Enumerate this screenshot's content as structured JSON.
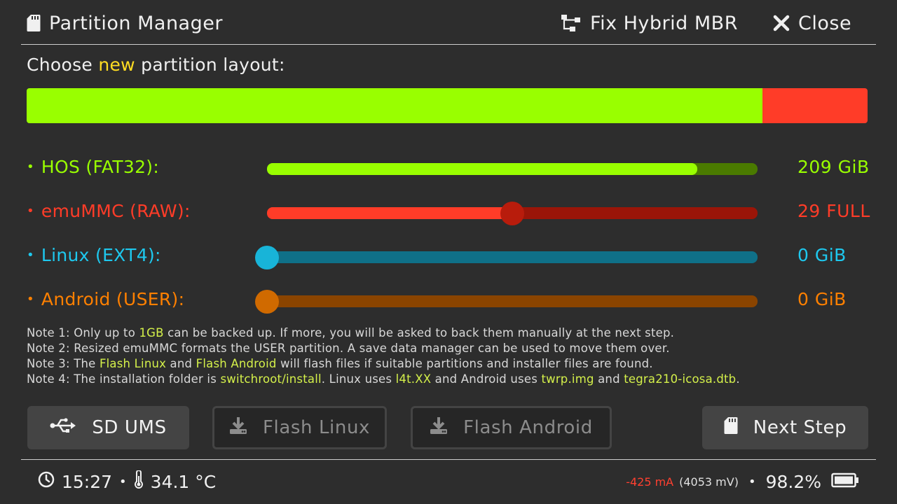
{
  "header": {
    "title": "Partition Manager",
    "fix_hybrid_label": "Fix Hybrid MBR",
    "close_label": "Close"
  },
  "layout_title": {
    "prefix": "Choose ",
    "highlight": "new",
    "suffix": " partition layout:"
  },
  "layout_bar": {
    "segments": [
      {
        "name": "HOS",
        "fraction": 0.875,
        "color": "#99ff00"
      },
      {
        "name": "emuMMC",
        "fraction": 0.125,
        "color": "#ff3c28"
      }
    ]
  },
  "partitions": [
    {
      "label": "HOS (FAT32):",
      "value": "209 GiB",
      "color": "#99ff00",
      "track_color": "#4a7a00",
      "level": 0.877,
      "has_knob": false
    },
    {
      "label": "emuMMC (RAW):",
      "value": "29 FULL",
      "color": "#ff3c28",
      "track_color": "#9a1508",
      "level": 0.5,
      "has_knob": true,
      "knob_color": "#b81c0c"
    },
    {
      "label": "Linux (EXT4):",
      "value": "0 GiB",
      "color": "#1ec8ee",
      "track_color": "#0f7088",
      "level": 0.0,
      "has_knob": true,
      "knob_color": "#18b4d8"
    },
    {
      "label": "Android (USER):",
      "value": "0 GiB",
      "color": "#ff8000",
      "track_color": "#8a4400",
      "level": 0.0,
      "has_knob": true,
      "knob_color": "#d06a00"
    }
  ],
  "notes": {
    "n1": {
      "a": "Note 1: Only up to ",
      "b": "1GB",
      "c": " can be backed up. If more, you will be asked to back them manually at the next step."
    },
    "n2": "Note 2: Resized emuMMC formats the USER partition. A save data manager can be used to move them over.",
    "n3": {
      "a": "Note 3: The ",
      "b": "Flash Linux",
      "c": " and ",
      "d": "Flash Android",
      "e": " will flash files if suitable partitions and installer files are found."
    },
    "n4": {
      "a": "Note 4: The installation folder is ",
      "b": "switchroot/install",
      "c": ". Linux uses ",
      "d": "l4t.XX",
      "e": " and Android uses ",
      "f": "twrp.img",
      "g": " and ",
      "h": "tegra210-icosa.dtb",
      "i": "."
    }
  },
  "buttons": {
    "sd_ums": "SD UMS",
    "flash_linux": "Flash Linux",
    "flash_android": "Flash Android",
    "next_step": "Next Step"
  },
  "footer": {
    "time": "15:27",
    "sep": "•",
    "temperature": "34.1 °C",
    "current": "-425 mA",
    "voltage": "(4053 mV)",
    "battery_percent": "98.2%"
  }
}
